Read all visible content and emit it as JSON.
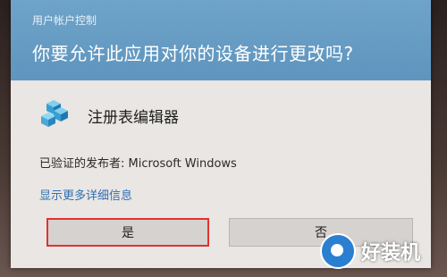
{
  "dialog": {
    "title": "用户帐户控制",
    "question": "你要允许此应用对你的设备进行更改吗?",
    "app_name": "注册表编辑器",
    "app_icon": "registry-editor-icon",
    "publisher": "已验证的发布者: Microsoft Windows",
    "details_link": "显示更多详细信息",
    "yes_label": "是",
    "no_label": "否"
  },
  "watermark": {
    "text": "好装机"
  },
  "colors": {
    "header": "#6a9fc6",
    "link": "#2f6fb3",
    "focus_outline": "#e0322f",
    "body": "#e9e6e3"
  }
}
